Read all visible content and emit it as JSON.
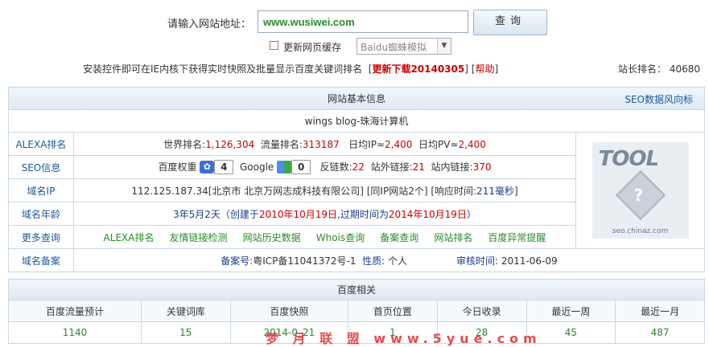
{
  "search": {
    "label": "请输入网站地址：",
    "value": "www.wusiwei.com",
    "button": "查询"
  },
  "options": {
    "update_cache_label": "更新网页缓存",
    "spider_select": "Baidu蜘蛛模拟"
  },
  "notice": {
    "text": "安装控件即可在IE内核下获得实时快照及批量显示百度关键词排名",
    "download_link": "更新下载20140305",
    "help_link": "帮助",
    "rank_label": "站长排名：",
    "rank_value": "40680"
  },
  "basic": {
    "header": "网站基本信息",
    "seo_link": "SEO数据风向标",
    "site_title": "wings blog-珠海计算机",
    "alexa": {
      "label": "ALEXA排名",
      "world_label": "世界排名:",
      "world_value": "1,126,304",
      "traffic_label": "流量排名:",
      "traffic_value": "313187",
      "ip_label": "日均IP≈",
      "ip_value": "2,400",
      "pv_label": "日均PV≈",
      "pv_value": "2,400"
    },
    "seo": {
      "label": "SEO信息",
      "baidu_label": "百度权重",
      "baidu_value": "4",
      "google_label": "Google",
      "google_value": "0",
      "backlinks_label": "反链数:",
      "backlinks_value": "22",
      "outlinks_label": "站外链接:",
      "outlinks_value": "21",
      "inlinks_label": "站内链接:",
      "inlinks_value": "370"
    },
    "ip": {
      "label": "域名IP",
      "text": "112.125.187.34[北京市 北京万网志成科技有限公司] [同IP网站2个] [响应时间:",
      "response": "211毫秒",
      "end": "]"
    },
    "age": {
      "label": "域名年龄",
      "value": "3年5月2天",
      "detail_pre": "（创建于",
      "created": "2010年10月19日",
      "detail_mid": ",过期时间为",
      "expires": "2014年10月19日",
      "detail_end": "）"
    },
    "more": {
      "label": "更多查询",
      "links": [
        "ALEXA排名",
        "友情链接检测",
        "网站历史数据",
        "Whois查询",
        "备案查询",
        "网站排名",
        "百度异常提醒"
      ]
    },
    "icp": {
      "label": "域名备案",
      "no_label": "备案号:",
      "no_value": "粤ICP备11041372号-1",
      "nature_label": "性质:",
      "nature_value": "个人",
      "audit_label": "审核时间:",
      "audit_value": "2011-06-09"
    },
    "thumbnail": {
      "brand": "TOOL",
      "caption": "seo.chinaz.com"
    }
  },
  "baidu": {
    "header": "百度相关",
    "columns": [
      "百度流量预计",
      "关键词库",
      "百度快照",
      "首页位置",
      "今日收录",
      "最近一周",
      "最近一月"
    ],
    "values": [
      "1140",
      "15",
      "2014-0_21",
      "1",
      "28",
      "45",
      "487"
    ]
  },
  "watermark": "梦 月 联 盟 www.5yue.com"
}
